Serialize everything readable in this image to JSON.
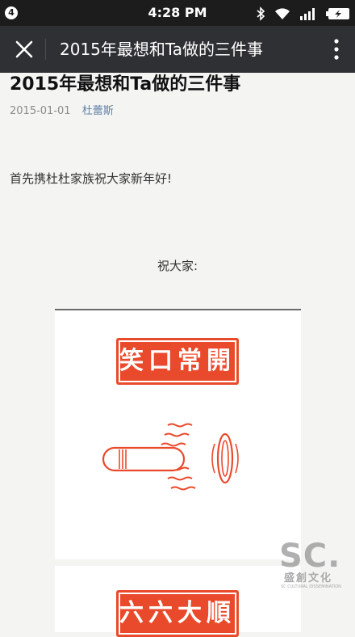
{
  "status_bar": {
    "notification_count": "4",
    "time": "4:28 PM"
  },
  "app_bar": {
    "title": "2015年最想和Ta做的三件事"
  },
  "article": {
    "title": "2015年最想和Ta做的三件事",
    "date": "2015-01-01",
    "author": "杜蕾斯",
    "paragraph": "首先携杜杜家族祝大家新年好!",
    "centered_line": "祝大家:",
    "image1_sign": "笑口常開",
    "image2_sign": "六六大順"
  },
  "watermark": {
    "logo": "SC.",
    "chinese": "盛創文化",
    "english": "SC CULTURAL DISSEMINATION"
  },
  "colors": {
    "sign_red": "#ea4a2c",
    "author_link": "#607fa6",
    "app_bar": "#2f3034"
  }
}
